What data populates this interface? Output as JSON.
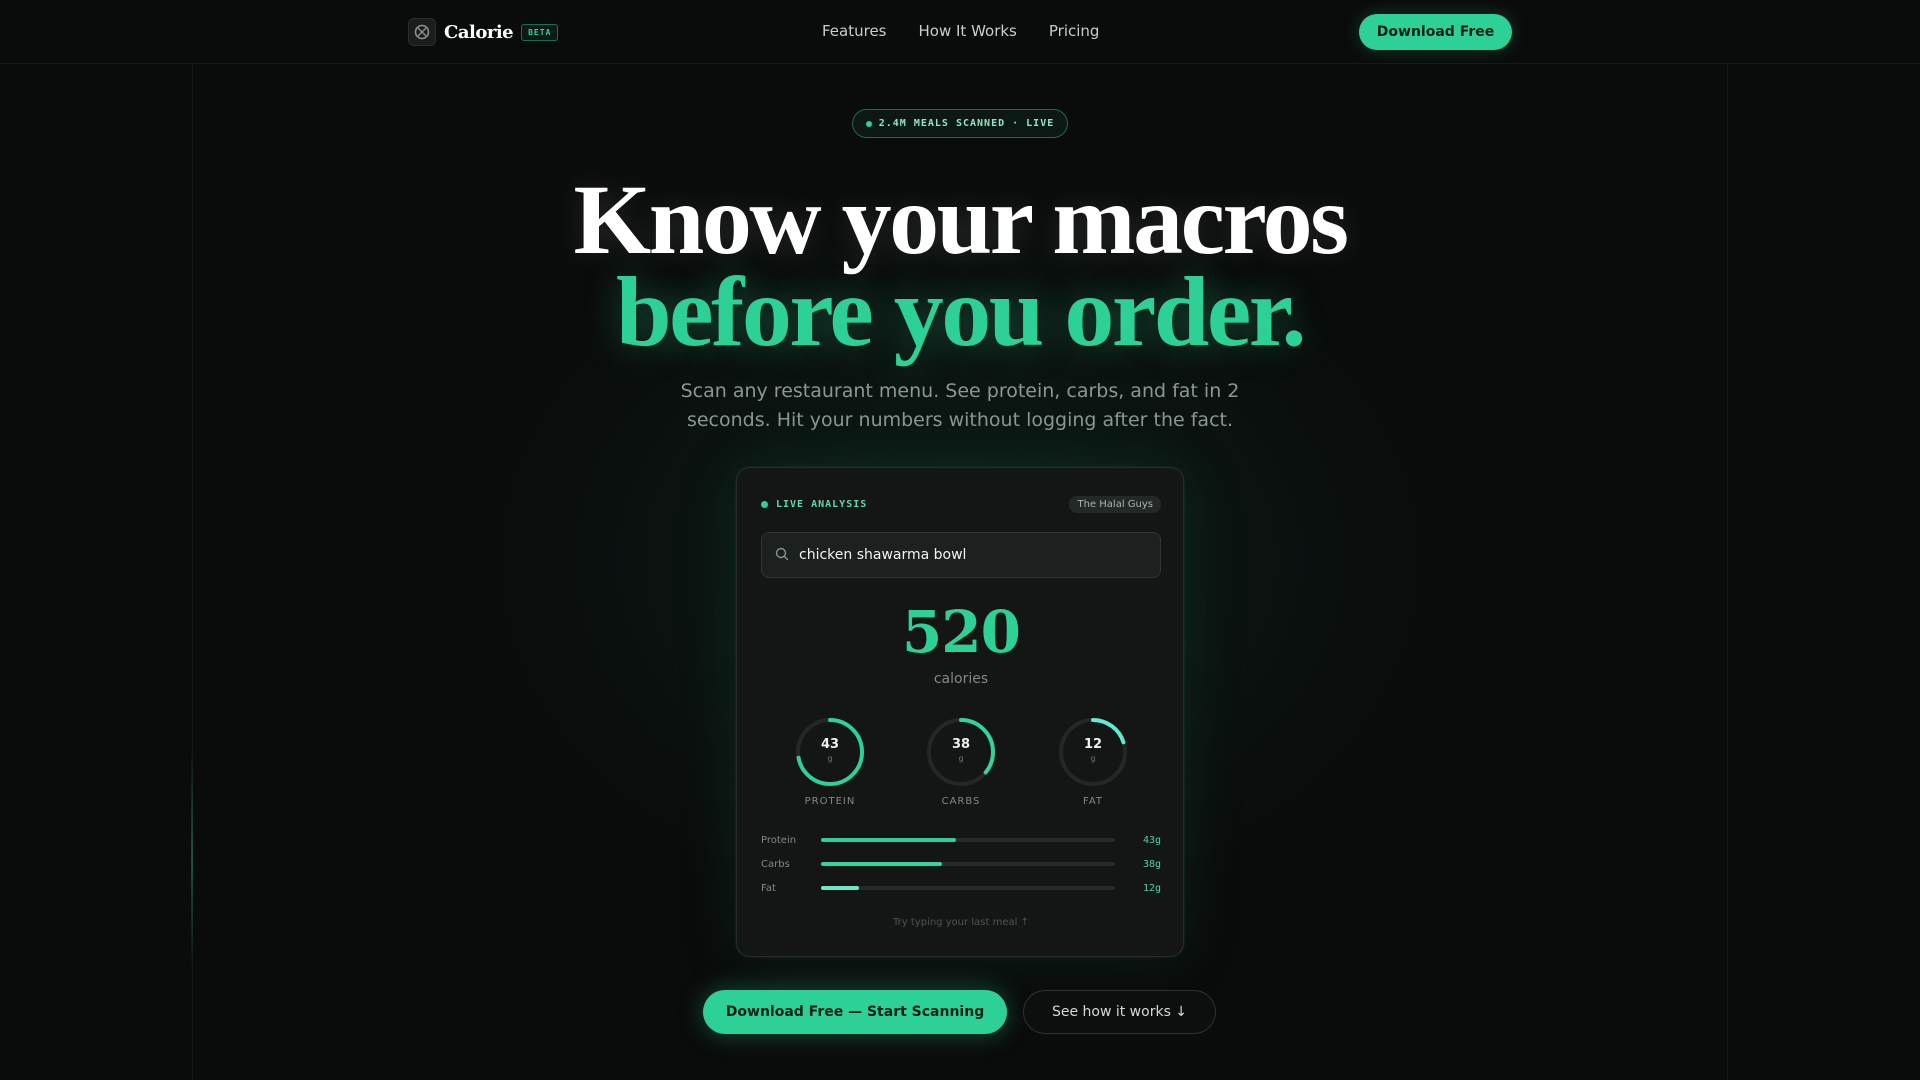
{
  "nav": {
    "brand": "Calorie",
    "badge": "BETA",
    "links": [
      "Features",
      "How It Works",
      "Pricing"
    ],
    "cta": "Download Free"
  },
  "hero": {
    "pill": "2.4M MEALS SCANNED · LIVE",
    "headline_1": "Know your macros",
    "headline_2": "before you order.",
    "subtitle": "Scan any restaurant menu. See protein, carbs, and fat in 2 seconds. Hit your numbers without logging after the fact."
  },
  "card": {
    "status": "LIVE ANALYSIS",
    "restaurant": "The Halal Guys",
    "search_value": "chicken shawarma bowl",
    "calories": "520",
    "calories_label": "calories",
    "rings": [
      {
        "value": "43",
        "unit": "g",
        "label": "PROTEIN",
        "fraction": 0.72,
        "color": "#2dd196"
      },
      {
        "value": "38",
        "unit": "g",
        "label": "CARBS",
        "fraction": 0.36,
        "color": "#34d399"
      },
      {
        "value": "12",
        "unit": "g",
        "label": "FAT",
        "fraction": 0.2,
        "color": "#5eead4"
      }
    ],
    "bars": [
      {
        "name": "Protein",
        "value": "43g",
        "fraction": 0.46,
        "color": "#2dd196"
      },
      {
        "name": "Carbs",
        "value": "38g",
        "fraction": 0.41,
        "color": "#34d399"
      },
      {
        "name": "Fat",
        "value": "12g",
        "fraction": 0.13,
        "color": "#6ee7c7"
      }
    ],
    "hint": "Try typing your last meal ↑"
  },
  "ctas": {
    "primary": "Download Free — Start Scanning",
    "secondary": "See how it works ↓"
  },
  "colors": {
    "accent": "#2dd196",
    "background": "#0a0b0b"
  }
}
